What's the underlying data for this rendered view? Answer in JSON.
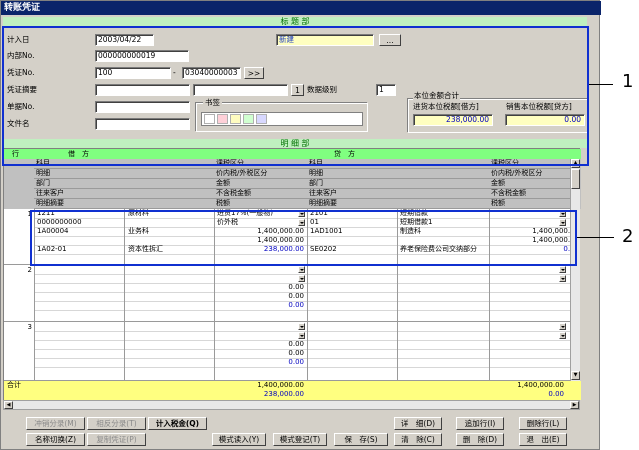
{
  "window": {
    "title": "转账凭证"
  },
  "sections": {
    "header": "标 题 部",
    "detail": "明 细 部"
  },
  "form": {
    "date_label": "计入日",
    "date_value": "2003/04/22",
    "status_value": "新建",
    "status_btn": "...",
    "internal_label": "内部No.",
    "internal_value": "000000000019",
    "voucher_label": "凭证No.",
    "voucher_value": "100",
    "voucher_sep": "-",
    "voucher_code": "03040000003",
    "voucher_btn": ">>",
    "summary_label": "凭证摘要",
    "level_btn": "1",
    "level_label": "数据级别",
    "level_value": "1",
    "attach_label": "单据No.",
    "file_label": "文件名",
    "bookmark_label": "书签",
    "bookmark_colors": [
      "#ffffff",
      "#ffd0d8",
      "#fffcc0",
      "#d0ffd0",
      "#d8d8ff"
    ],
    "total_group_label": "本位金额合计",
    "debit_total_label": "进货本位税额[借方]",
    "debit_total_value": "238,000.00",
    "credit_total_label": "销售本位税额[贷方]",
    "credit_total_value": "0.00"
  },
  "grid": {
    "col_row": "行",
    "col_debit": "借　方",
    "col_credit": "贷　方",
    "header_rows": [
      [
        "科目",
        "课税区分",
        "科目",
        "课税区分"
      ],
      [
        "明细",
        "价内税/外税区分",
        "明细",
        "价内税/外税区分"
      ],
      [
        "部门",
        "金额",
        "部门",
        "金额"
      ],
      [
        "往来客户",
        "不含税金额",
        "往来客户",
        "不含税金额"
      ],
      [
        "明细摘要",
        "税额",
        "明细摘要",
        "税额"
      ]
    ],
    "rows": [
      {
        "no": "1",
        "d_acct": "1211",
        "d_acct_name": "原材料",
        "d_tax": "进货17%(一般物)",
        "d_detail": "0000000000",
        "d_tax_type": "价外税",
        "d_dept": "1A00004",
        "d_dept_name": "业务科",
        "d_amount": "1,400,000.00",
        "d_excl": "1,400,000.00",
        "d_sum_code": "1A02-01",
        "d_sum_name": "资本性拆汇",
        "d_taxamt": "238,000.00",
        "c_acct": "2101",
        "c_acct_name": "短期借款",
        "c_detail": "01",
        "c_detail_name": "短期借款1",
        "c_dept": "1AD1001",
        "c_dept_name": "制造科",
        "c_amount": "1,400,000.00",
        "c_excl": "1,400,000.00",
        "c_sum_code": "SE0202",
        "c_sum_name": "养老保险费公司交纳部分",
        "c_taxamt": "0.00"
      },
      {
        "no": "2",
        "d_amount": "0.00",
        "d_excl": "0.00",
        "d_taxamt": "0.00"
      },
      {
        "no": "3",
        "d_amount": "0.00",
        "d_excl": "0.00",
        "d_taxamt": "0.00"
      }
    ],
    "total_label": "合计",
    "total_debit_amount": "1,400,000.00",
    "total_debit_tax": "238,000.00",
    "total_credit_amount": "1,400,000.00",
    "total_credit_tax": "0.00"
  },
  "buttons": {
    "offset": "冲销分录(M)",
    "similar": "相反分录(T)",
    "tax": "计入税金(Q)",
    "detail": "详　细(D)",
    "add_row": "追加行(I)",
    "del_row": "删除行(L)",
    "rename": "名称切换(Z)",
    "copy": "复制凭证(P)",
    "pattern_read": "模式读入(Y)",
    "pattern_reg": "模式登记(T)",
    "save": "保　存(S)",
    "clear": "清　除(C)",
    "delete": "删　除(D)",
    "exit": "退　出(E)"
  },
  "callouts": [
    "1",
    "2"
  ]
}
